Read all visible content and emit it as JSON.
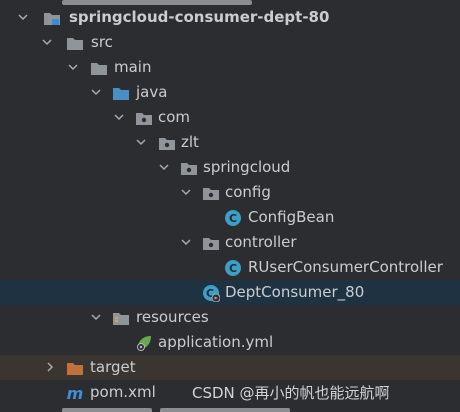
{
  "tree": {
    "items": [
      {
        "label": "springcloud-consumer-dept-80",
        "icon": "module-folder-icon",
        "expanded": true,
        "bold": true
      },
      {
        "label": "src",
        "icon": "folder-icon",
        "expanded": true
      },
      {
        "label": "main",
        "icon": "folder-icon",
        "expanded": true
      },
      {
        "label": "java",
        "icon": "source-root-folder-icon",
        "expanded": true
      },
      {
        "label": "com",
        "icon": "package-icon",
        "expanded": true
      },
      {
        "label": "zlt",
        "icon": "package-icon",
        "expanded": true
      },
      {
        "label": "springcloud",
        "icon": "package-icon",
        "expanded": true
      },
      {
        "label": "config",
        "icon": "package-icon",
        "expanded": true
      },
      {
        "label": "ConfigBean",
        "icon": "java-class-icon"
      },
      {
        "label": "controller",
        "icon": "package-icon",
        "expanded": true
      },
      {
        "label": "RUserConsumerController",
        "icon": "java-class-icon"
      },
      {
        "label": "DeptConsumer_80",
        "icon": "spring-boot-main-class-icon",
        "selected": true
      },
      {
        "label": "resources",
        "icon": "resources-folder-icon",
        "expanded": true
      },
      {
        "label": "application.yml",
        "icon": "spring-config-icon"
      },
      {
        "label": "target",
        "icon": "excluded-folder-icon",
        "expanded": false,
        "hover": true
      },
      {
        "label": "pom.xml",
        "icon": "maven-icon"
      }
    ]
  },
  "watermark": "CSDN @再小的帆也能远航啊",
  "colors": {
    "background": "#2b2d30",
    "selection": "#1f3242",
    "hover_row": "#3a3530",
    "text": "#c9cdd2",
    "folder": "#8f959b",
    "java_class": "#3c9fc7",
    "excluded_folder": "#c2713b",
    "maven": "#3f8fd6"
  }
}
